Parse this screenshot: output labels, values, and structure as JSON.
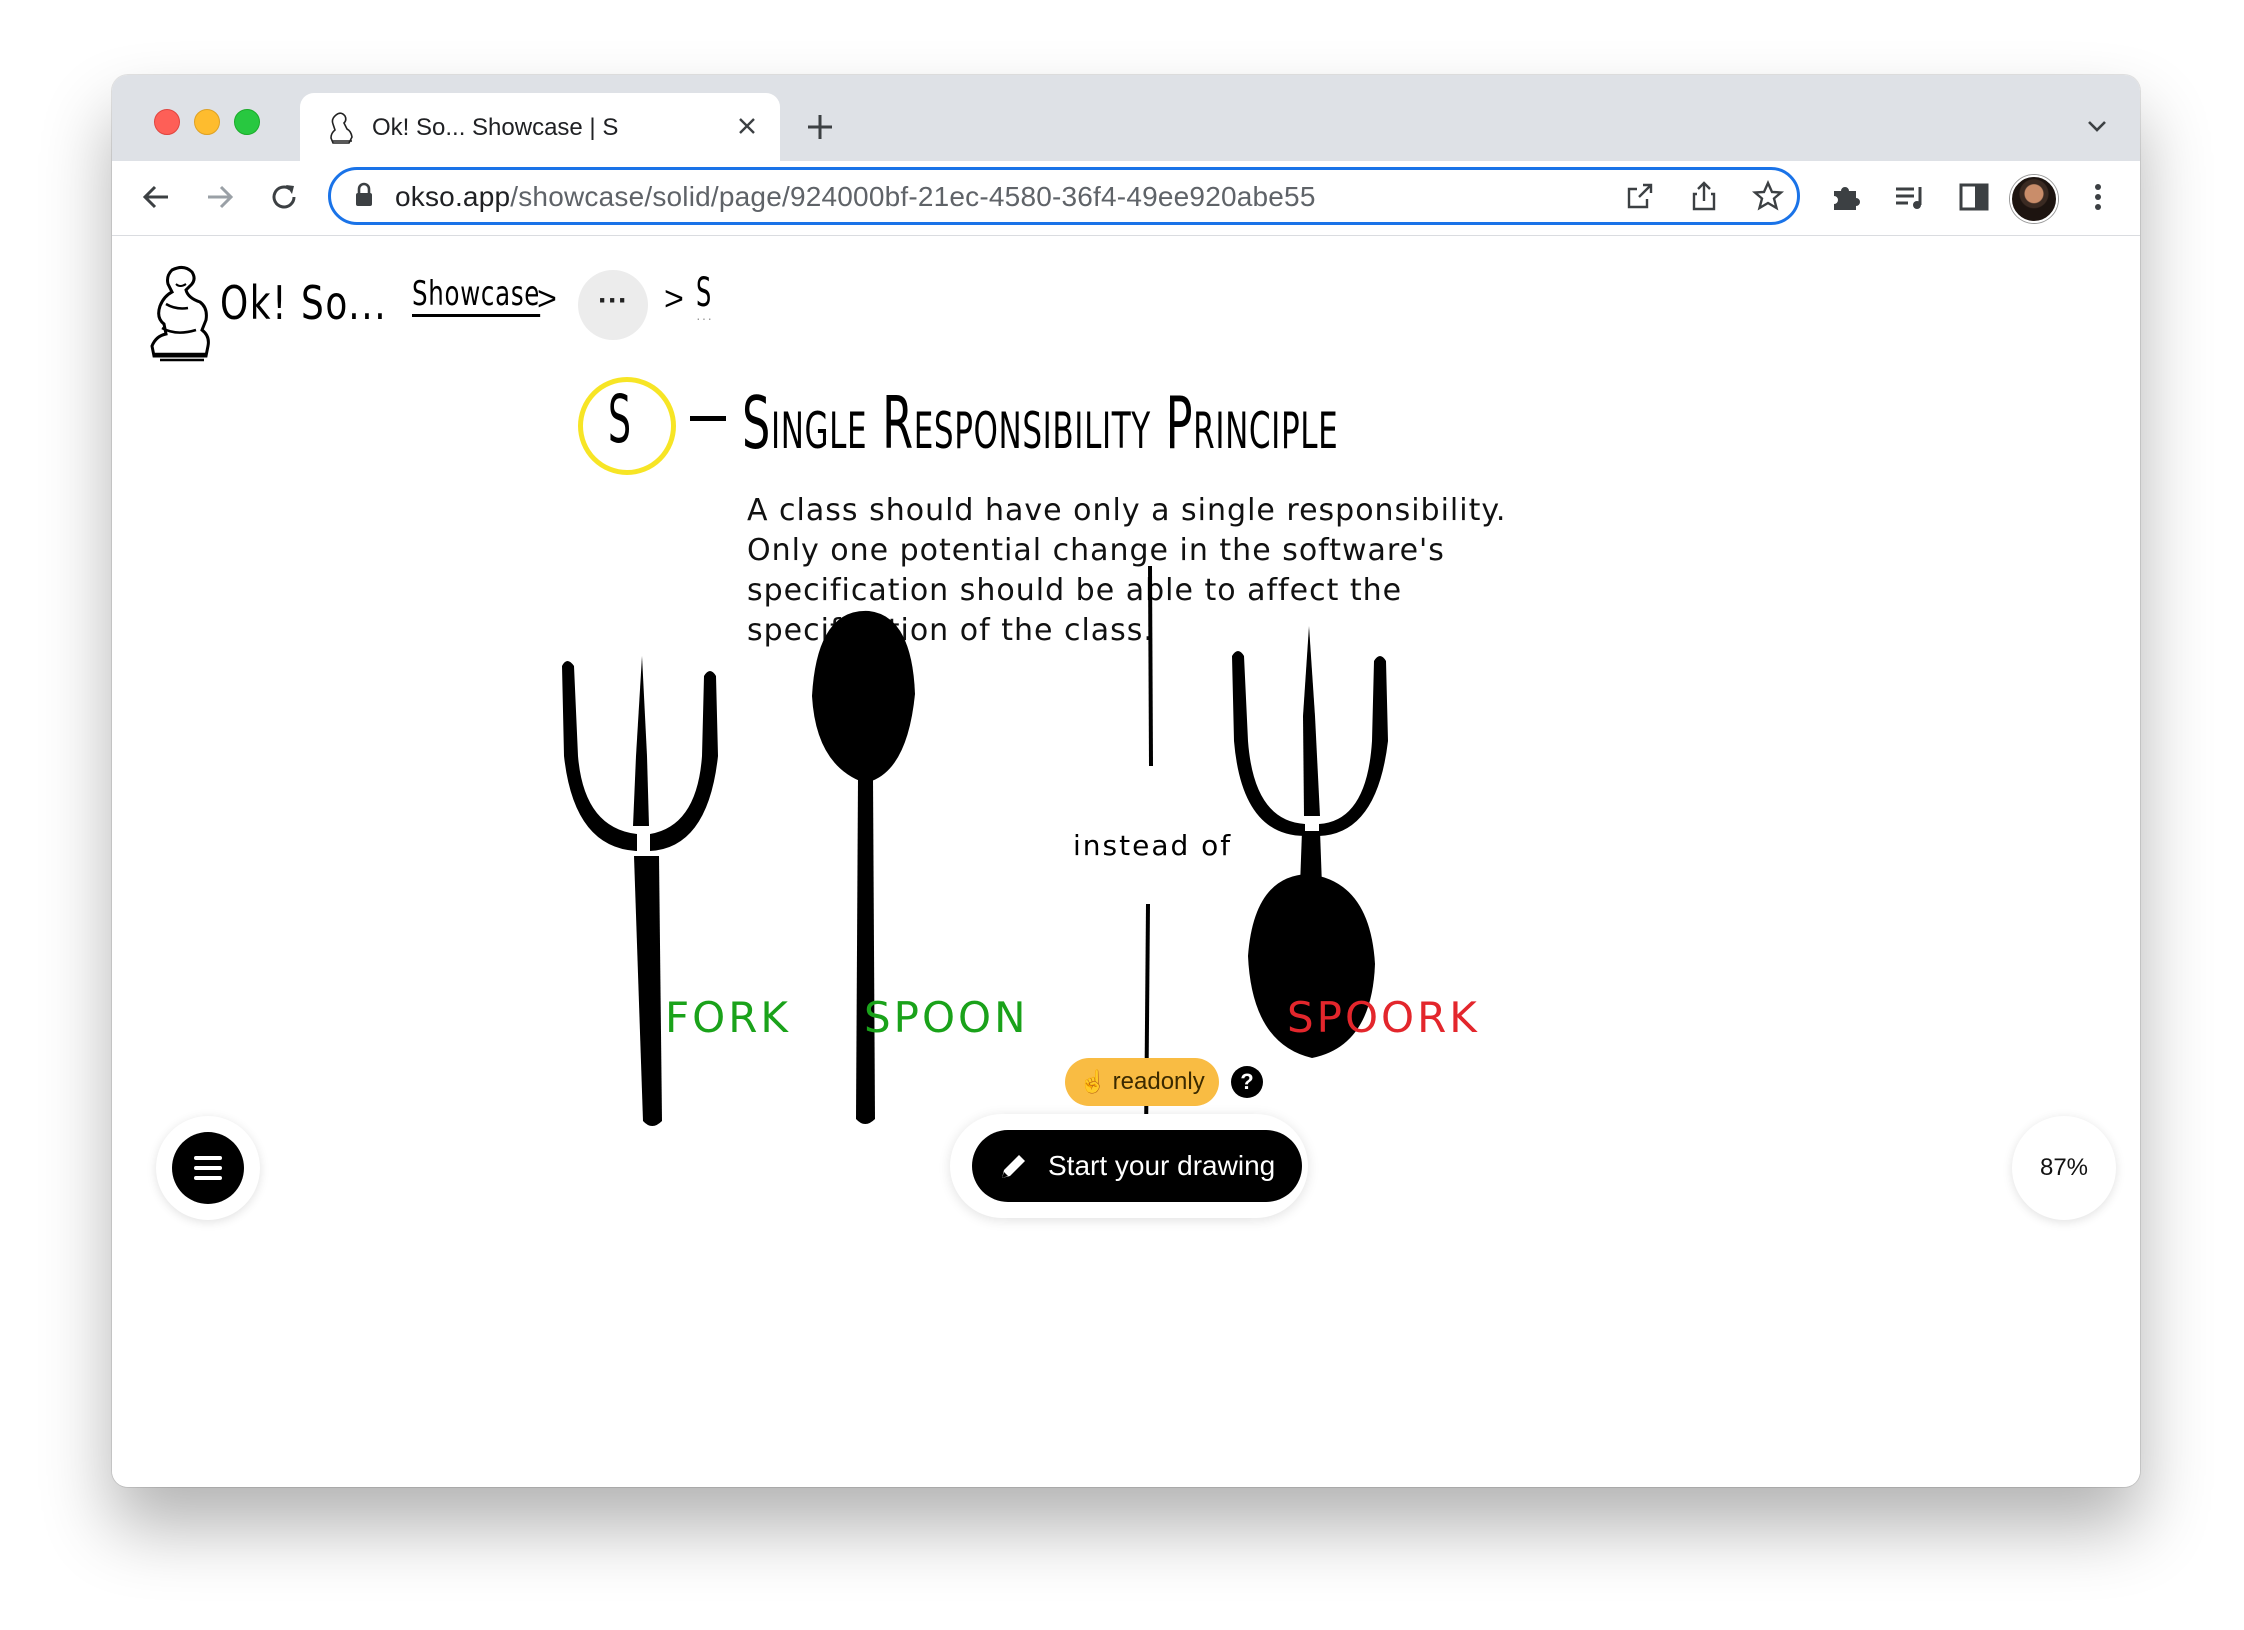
{
  "browser": {
    "tab_title": "Ok! So... Showcase | S",
    "url_host": "okso.app",
    "url_path": "/showcase/solid/page/924000bf-21ec-4580-36f4-49ee920abe55"
  },
  "breadcrumb": {
    "logo_text": "Ok! So...",
    "showcase": "Showcase",
    "separator": ">",
    "more": "···",
    "current": "S",
    "current_dots": "···"
  },
  "page": {
    "letter": "S",
    "title": "Single Responsibility Principle",
    "description": [
      "A class should have only a single responsibility.",
      "Only one potential change in the software's",
      "specification should be able to affect the",
      "specification of the class."
    ]
  },
  "drawing": {
    "label_fork": "FORK",
    "label_spoon": "SPOON",
    "label_instead": "instead of",
    "label_spoork": "SPOORK",
    "colors": {
      "good": "#1aa21a",
      "bad": "#e3262c",
      "highlight": "#f7e525"
    }
  },
  "ui": {
    "readonly": "readonly",
    "help": "?",
    "start_drawing": "Start your drawing",
    "zoom": "87%"
  }
}
